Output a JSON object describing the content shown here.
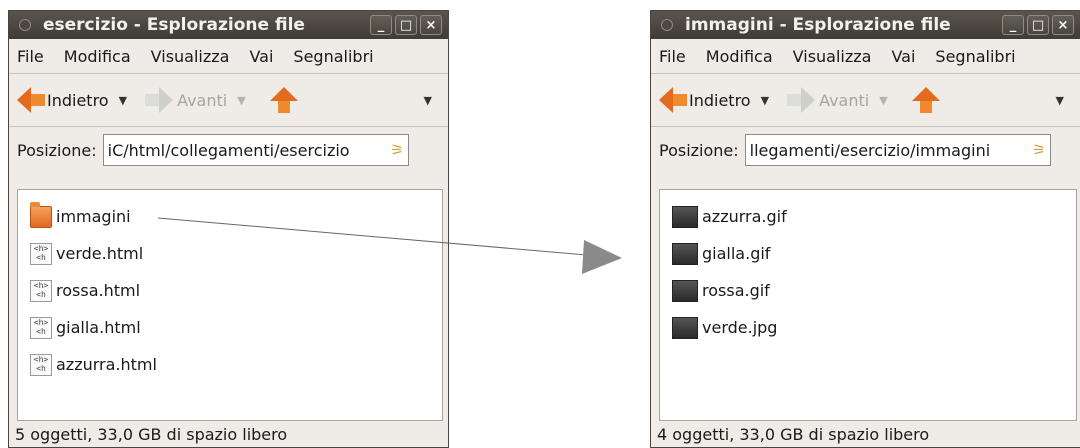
{
  "left_window": {
    "title": "esercizio - Esplorazione file",
    "menu": [
      "File",
      "Modifica",
      "Visualizza",
      "Vai",
      "Segnalibri"
    ],
    "toolbar": {
      "back": "Indietro",
      "forward": "Avanti"
    },
    "location_label": "Posizione:",
    "location_value": "iC/html/collegamenti/esercizio",
    "files": [
      {
        "name": "immagini",
        "icon": "folder-icon"
      },
      {
        "name": "verde.html",
        "icon": "html-file-icon"
      },
      {
        "name": "rossa.html",
        "icon": "html-file-icon"
      },
      {
        "name": "gialla.html",
        "icon": "html-file-icon"
      },
      {
        "name": "azzurra.html",
        "icon": "html-file-icon"
      }
    ],
    "status": "5 oggetti, 33,0 GB di spazio libero"
  },
  "right_window": {
    "title": "immagini - Esplorazione file",
    "menu": [
      "File",
      "Modifica",
      "Visualizza",
      "Vai",
      "Segnalibri"
    ],
    "toolbar": {
      "back": "Indietro",
      "forward": "Avanti"
    },
    "location_label": "Posizione:",
    "location_value": "llegamenti/esercizio/immagini",
    "files": [
      {
        "name": "azzurra.gif",
        "icon": "image-file-icon"
      },
      {
        "name": "gialla.gif",
        "icon": "image-file-icon"
      },
      {
        "name": "rossa.gif",
        "icon": "image-file-icon"
      },
      {
        "name": "verde.jpg",
        "icon": "image-file-icon"
      }
    ],
    "status": "4 oggetti, 33,0 GB di spazio libero"
  },
  "window_buttons": {
    "minimize": "_",
    "maximize": "□",
    "close": "×"
  },
  "colors": {
    "titlebar": "#4a463f",
    "accent_orange": "#e36b1d",
    "window_bg": "#efebe7"
  }
}
